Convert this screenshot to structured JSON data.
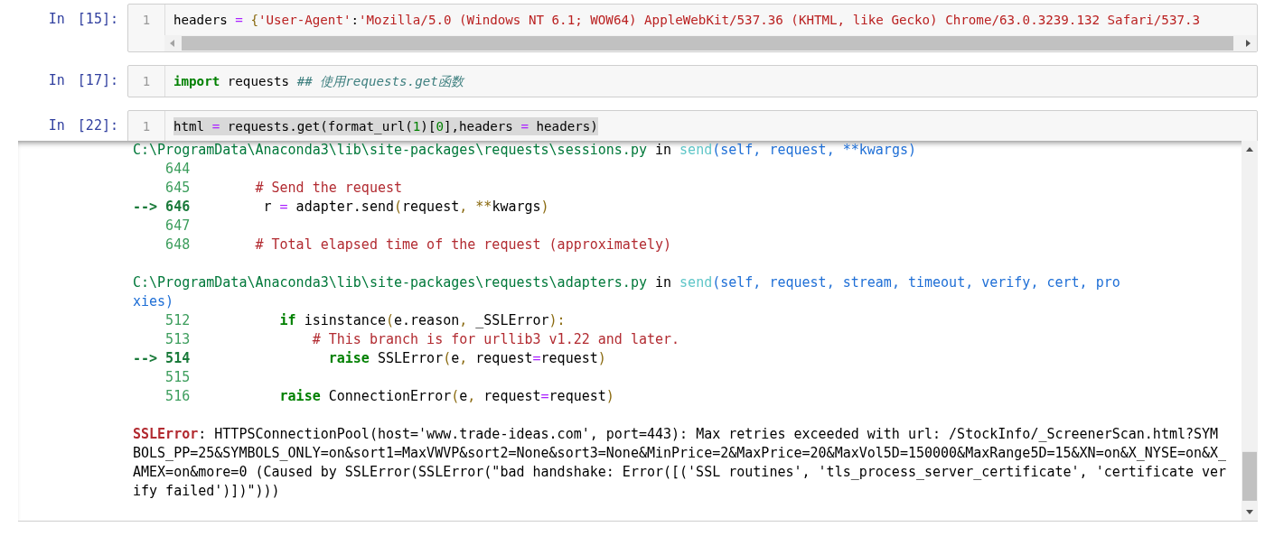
{
  "cells": [
    {
      "prompt": "In",
      "count": "[15]:",
      "line_number": "1",
      "highlighted": false,
      "horizontal_scrollbar": true,
      "segments": [
        {
          "text": "headers ",
          "kind": "plain"
        },
        {
          "text": "=",
          "kind": "operator"
        },
        {
          "text": " {",
          "kind": "punct"
        },
        {
          "text": "'User-Agent'",
          "kind": "string"
        },
        {
          "text": ":",
          "kind": "plain"
        },
        {
          "text": "'Mozilla/5.0 (Windows NT 6.1; WOW64) AppleWebKit/537.36 (KHTML, like Gecko) Chrome/63.0.3239.132 Safari/537.3",
          "kind": "string"
        }
      ]
    },
    {
      "prompt": "In",
      "count": "[17]:",
      "line_number": "1",
      "highlighted": false,
      "horizontal_scrollbar": false,
      "segments": [
        {
          "text": "import",
          "kind": "keyword"
        },
        {
          "text": " requests ",
          "kind": "plain"
        },
        {
          "text": "## 使用requests.get函数",
          "kind": "comment_italic"
        }
      ]
    },
    {
      "prompt": "In",
      "count": "[22]:",
      "line_number": "1",
      "highlighted": true,
      "horizontal_scrollbar": false,
      "segments": [
        {
          "text": "html ",
          "kind": "plain"
        },
        {
          "text": "=",
          "kind": "operator"
        },
        {
          "text": " requests.get(format_url(",
          "kind": "plain"
        },
        {
          "text": "1",
          "kind": "number"
        },
        {
          "text": ")[",
          "kind": "plain"
        },
        {
          "text": "0",
          "kind": "number"
        },
        {
          "text": "],headers ",
          "kind": "plain"
        },
        {
          "text": "=",
          "kind": "operator"
        },
        {
          "text": " headers)",
          "kind": "plain"
        }
      ]
    }
  ],
  "output": {
    "lines": [
      {
        "kind": "text",
        "segments": [
          {
            "text": "C:\\ProgramData\\Anaconda3\\lib\\site-packages\\requests\\sessions.py",
            "kind": "path"
          },
          {
            "text": " in ",
            "kind": "plain"
          },
          {
            "text": "send",
            "kind": "function"
          },
          {
            "text": "(self, request, **kwargs)",
            "kind": "args"
          }
        ]
      },
      {
        "kind": "text",
        "segments": [
          {
            "text": "    644",
            "kind": "lineno"
          }
        ]
      },
      {
        "kind": "text",
        "segments": [
          {
            "text": "    645",
            "kind": "lineno"
          },
          {
            "text": "        # Send the request",
            "kind": "comment"
          }
        ]
      },
      {
        "kind": "text",
        "segments": [
          {
            "text": "--> 646",
            "kind": "arrow"
          },
          {
            "text": "         r ",
            "kind": "plain"
          },
          {
            "text": "=",
            "kind": "operator"
          },
          {
            "text": " adapter.send",
            "kind": "plain"
          },
          {
            "text": "(",
            "kind": "punct"
          },
          {
            "text": "request",
            "kind": "plain"
          },
          {
            "text": ", **",
            "kind": "punct"
          },
          {
            "text": "kwargs",
            "kind": "plain"
          },
          {
            "text": ")",
            "kind": "punct"
          }
        ]
      },
      {
        "kind": "text",
        "segments": [
          {
            "text": "    647",
            "kind": "lineno"
          }
        ]
      },
      {
        "kind": "text",
        "segments": [
          {
            "text": "    648",
            "kind": "lineno"
          },
          {
            "text": "        # Total elapsed time of the request (approximately)",
            "kind": "comment"
          }
        ]
      },
      {
        "kind": "blank"
      },
      {
        "kind": "text",
        "segments": [
          {
            "text": "C:\\ProgramData\\Anaconda3\\lib\\site-packages\\requests\\adapters.py",
            "kind": "path"
          },
          {
            "text": " in ",
            "kind": "plain"
          },
          {
            "text": "send",
            "kind": "function"
          },
          {
            "text": "(self, request, stream, timeout, verify, cert, pro",
            "kind": "args"
          }
        ]
      },
      {
        "kind": "text",
        "segments": [
          {
            "text": "xies)",
            "kind": "args"
          }
        ]
      },
      {
        "kind": "text",
        "segments": [
          {
            "text": "    512",
            "kind": "lineno"
          },
          {
            "text": "           if",
            "kind": "keyword"
          },
          {
            "text": " isinstance",
            "kind": "plain"
          },
          {
            "text": "(",
            "kind": "punct"
          },
          {
            "text": "e.reason",
            "kind": "plain"
          },
          {
            "text": ", ",
            "kind": "punct"
          },
          {
            "text": "_SSLError",
            "kind": "plain"
          },
          {
            "text": "):",
            "kind": "punct"
          }
        ]
      },
      {
        "kind": "text",
        "segments": [
          {
            "text": "    513",
            "kind": "lineno"
          },
          {
            "text": "               # This branch is for urllib3 v1.22 and later.",
            "kind": "comment"
          }
        ]
      },
      {
        "kind": "text",
        "segments": [
          {
            "text": "--> 514",
            "kind": "arrow"
          },
          {
            "text": "                 raise",
            "kind": "keyword"
          },
          {
            "text": " SSLError",
            "kind": "plain"
          },
          {
            "text": "(",
            "kind": "punct"
          },
          {
            "text": "e",
            "kind": "plain"
          },
          {
            "text": ", ",
            "kind": "punct"
          },
          {
            "text": "request",
            "kind": "plain"
          },
          {
            "text": "=",
            "kind": "operator"
          },
          {
            "text": "request",
            "kind": "plain"
          },
          {
            "text": ")",
            "kind": "punct"
          }
        ]
      },
      {
        "kind": "text",
        "segments": [
          {
            "text": "    515",
            "kind": "lineno"
          }
        ]
      },
      {
        "kind": "text",
        "segments": [
          {
            "text": "    516",
            "kind": "lineno"
          },
          {
            "text": "           raise",
            "kind": "keyword"
          },
          {
            "text": " ConnectionError",
            "kind": "plain"
          },
          {
            "text": "(",
            "kind": "punct"
          },
          {
            "text": "e",
            "kind": "plain"
          },
          {
            "text": ", ",
            "kind": "punct"
          },
          {
            "text": "request",
            "kind": "plain"
          },
          {
            "text": "=",
            "kind": "operator"
          },
          {
            "text": "request",
            "kind": "plain"
          },
          {
            "text": ")",
            "kind": "punct"
          }
        ]
      },
      {
        "kind": "blank"
      },
      {
        "kind": "text",
        "segments": [
          {
            "text": "SSLError",
            "kind": "error"
          },
          {
            "text": ": HTTPSConnectionPool(host='www.trade-ideas.com', port=443): Max retries exceeded with url: /StockInfo/_ScreenerScan.html?SYM",
            "kind": "plain"
          }
        ]
      },
      {
        "kind": "text",
        "segments": [
          {
            "text": "BOLS_PP=25&SYMBOLS_ONLY=on&sort1=MaxVWVP&sort2=None&sort3=None&MinPrice=2&MaxPrice=20&MaxVol5D=150000&MaxRange5D=15&XN=on&X_NYSE=on&X_",
            "kind": "plain"
          }
        ]
      },
      {
        "kind": "text",
        "segments": [
          {
            "text": "AMEX=on&more=0 (Caused by SSLError(SSLError(\"bad handshake: Error([('SSL routines', 'tls_process_server_certificate', 'certificate ver",
            "kind": "plain"
          }
        ]
      },
      {
        "kind": "text",
        "segments": [
          {
            "text": "ify failed')])\")))",
            "kind": "plain"
          }
        ]
      }
    ]
  }
}
